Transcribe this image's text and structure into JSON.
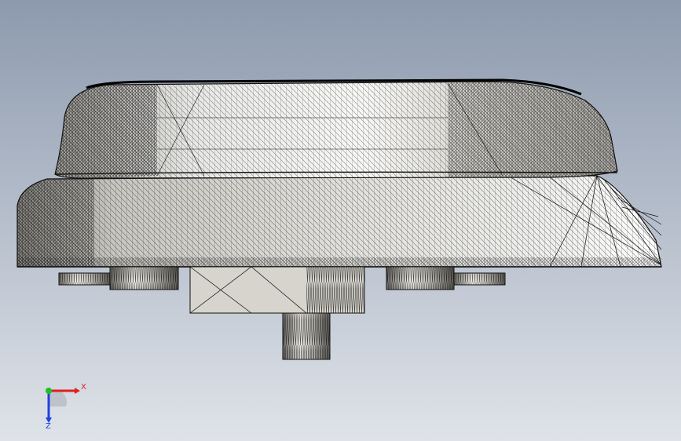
{
  "viewport": {
    "background_top": "#8d9aae",
    "background_bottom": "#dfe3e9"
  },
  "model": {
    "name": "mesh-3d-model",
    "body_fill": "#d4d2cc",
    "body_light": "#f4f4f2",
    "body_dark": "#9c9a94",
    "mesh_color": "#111111"
  },
  "triad": {
    "x_label": "X",
    "y_label": "Y",
    "z_label": "Z",
    "x_color": "#e02020",
    "y_color": "#20c020",
    "z_color": "#2040e0"
  }
}
